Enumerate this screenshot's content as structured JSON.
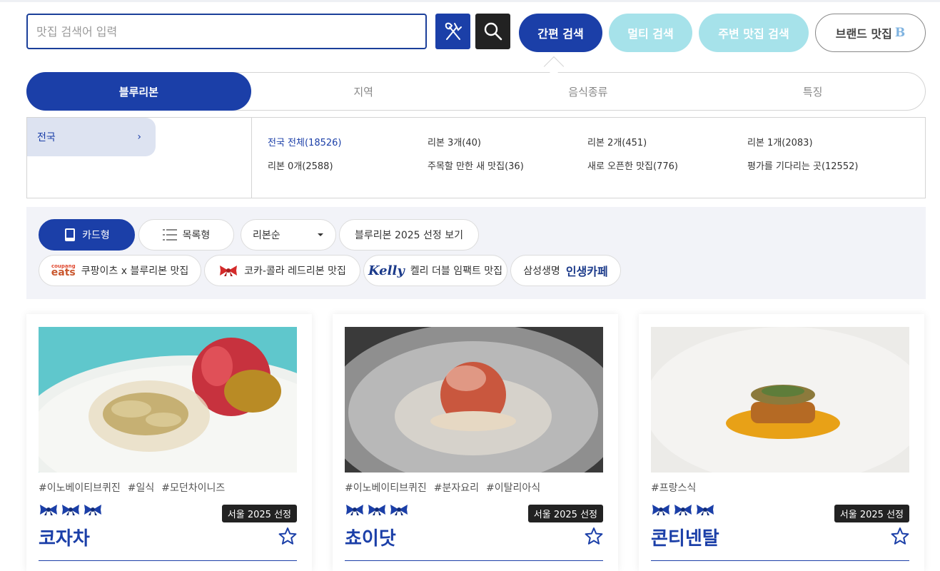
{
  "search": {
    "placeholder": "맛집 검색어 입력",
    "modes": [
      "간편 검색",
      "멀티 검색",
      "주변 맛집 검색",
      "브랜드 맛집"
    ],
    "brand_mark": "B"
  },
  "tabs": [
    "블루리본",
    "지역",
    "음식종류",
    "특징"
  ],
  "region": {
    "label": "전국",
    "chevron": "›"
  },
  "filters": [
    "전국 전체(18526)",
    "리본 3개(40)",
    "리본 2개(451)",
    "리본 1개(2083)",
    "리본 0개(2588)",
    "주목할 만한 새 맛집(36)",
    "새로 오픈한 맛집(776)",
    "평가를 기다리는 곳(12552)"
  ],
  "toolbar": {
    "card_view": "카드형",
    "list_view": "목록형",
    "sort": "리본순",
    "selection": "블루리본 2025 선정 보기",
    "partners": {
      "coupang_logo_top": "coupang",
      "coupang_logo_bottom": "eats",
      "coupang_label": "쿠팡이츠 x 블루리본 맛집",
      "coke_label": "코카-콜라 레드리본 맛집",
      "kelly_logo": "Kelly",
      "kelly_label": "켈리 더블 임팩트 맛집",
      "samsung_label": "삼성생명",
      "samsung_logo": "인생카페"
    }
  },
  "cards": [
    {
      "tags": [
        "#이노베이티브퀴진",
        "#일식",
        "#모던차이니즈"
      ],
      "ribbons": 3,
      "badge": "서울 2025 선정",
      "name": "코자차"
    },
    {
      "tags": [
        "#이노베이티브퀴진",
        "#분자요리",
        "#이탈리아식"
      ],
      "ribbons": 3,
      "badge": "서울 2025 선정",
      "name": "쵸이닷"
    },
    {
      "tags": [
        "#프랑스식"
      ],
      "ribbons": 3,
      "badge": "서울 2025 선정",
      "name": "콘티넨탈"
    }
  ],
  "colors": {
    "primary": "#1b3fa8",
    "mint": "#a6e2ea",
    "toolbar_bg": "#f2f3f8"
  }
}
